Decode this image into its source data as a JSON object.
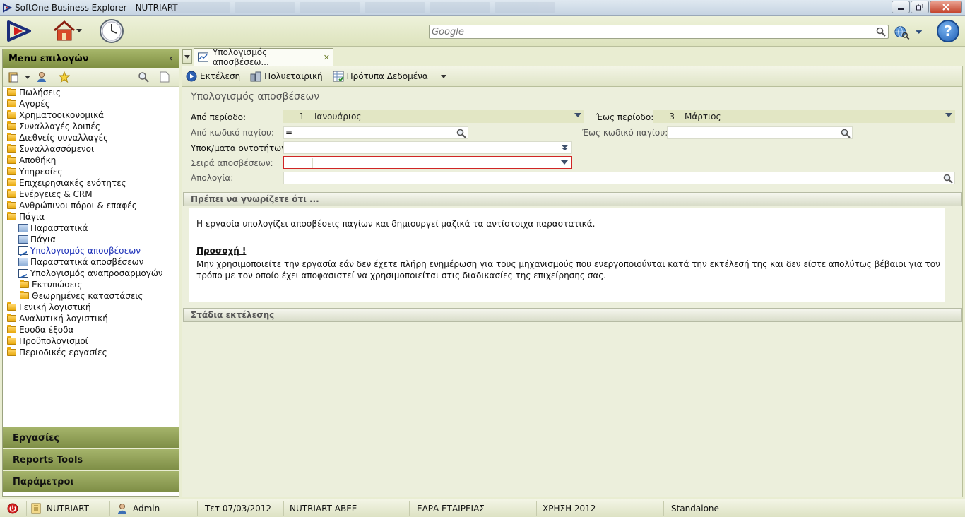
{
  "window": {
    "title": "SoftOne Business Explorer - NUTRIART",
    "minimize": "0",
    "maximize": "1",
    "close": "r"
  },
  "toolbar": {
    "search_placeholder": "Google",
    "help_label": "?"
  },
  "sidebar": {
    "header": "Menu επιλογών",
    "items": [
      {
        "label": "Πωλήσεις"
      },
      {
        "label": "Αγορές"
      },
      {
        "label": "Χρηματοοικονομικά"
      },
      {
        "label": "Συναλλαγές λοιπές"
      },
      {
        "label": "Διεθνείς συναλλαγές"
      },
      {
        "label": "Συναλλασσόμενοι"
      },
      {
        "label": "Αποθήκη"
      },
      {
        "label": "Υπηρεσίες"
      },
      {
        "label": "Επιχειρησιακές ενότητες"
      },
      {
        "label": "Ενέργειες & CRM"
      },
      {
        "label": "Ανθρώπινοι πόροι & επαφές"
      },
      {
        "label": "Πάγια"
      },
      {
        "label": "Παραστατικά"
      },
      {
        "label": "Πάγια"
      },
      {
        "label": "Υπολογισμός αποσβέσεων"
      },
      {
        "label": "Παραστατικά αποσβέσεων"
      },
      {
        "label": "Υπολογισμός αναπροσαρμογών"
      },
      {
        "label": "Εκτυπώσεις"
      },
      {
        "label": "Θεωρημένες καταστάσεις"
      },
      {
        "label": "Γενική λογιστική"
      },
      {
        "label": "Αναλυτική λογιστική"
      },
      {
        "label": "Εσοδα έξοδα"
      },
      {
        "label": "Προϋπολογισμοί"
      },
      {
        "label": "Περιοδικές εργασίες"
      }
    ],
    "sections": [
      "Εργασίες",
      "Reports Tools",
      "Παράμετροι"
    ]
  },
  "tab": {
    "label": "Υπολογισμός αποσβέσεω..."
  },
  "actions": {
    "run": "Εκτέλεση",
    "multicompany": "Πολυεταιρική",
    "templates": "Πρότυπα Δεδομένα"
  },
  "form": {
    "title": "Υπολογισμός αποσβέσεων",
    "from_period_label": "Από περίοδο:",
    "from_period_num": "1",
    "from_period_name": "Ιανουάριος",
    "to_period_label": "Έως περίοδο:",
    "to_period_num": "3",
    "to_period_name": "Μάρτιος",
    "from_code_label": "Από κωδικό παγίου:",
    "from_code_value": "=",
    "to_code_label": "Έως κωδικό παγίου:",
    "entity_label": "Υποκ/ματα οντοτήτων:",
    "series_label": "Σειρά αποσβέσεων:",
    "reason_label": "Απολογία:"
  },
  "info": {
    "header": "Πρέπει να γνωρίζετε ότι ...",
    "text1": "Η εργασία υπολογίζει αποσβέσεις παγίων και δημιουργεί μαζικά τα αντίστοιχα παραστατικά.",
    "warning_title": "Προσοχή !",
    "warning_text": "Μην χρησιμοποιείτε την εργασία εάν δεν έχετε πλήρη ενημέρωση για τους μηχανισμούς που ενεργοποιούνται κατά την εκτέλεσή της και δεν είστε απολύτως βέβαιοι για τον τρόπο με τον οποίο έχει αποφασιστεί να χρησιμοποιείται στις διαδικασίες της επιχείρησης σας."
  },
  "stages": {
    "header": "Στάδια εκτέλεσης"
  },
  "statusbar": {
    "company": "NUTRIART",
    "user": "Admin",
    "date": "Τετ 07/03/2012",
    "company_name": "NUTRIART ΑΒΕΕ",
    "branch": "ΕΔΡΑ ΕΤΑΙΡΕΙΑΣ",
    "fiscal_year": "ΧΡΗΣΗ 2012",
    "mode": "Standalone"
  }
}
